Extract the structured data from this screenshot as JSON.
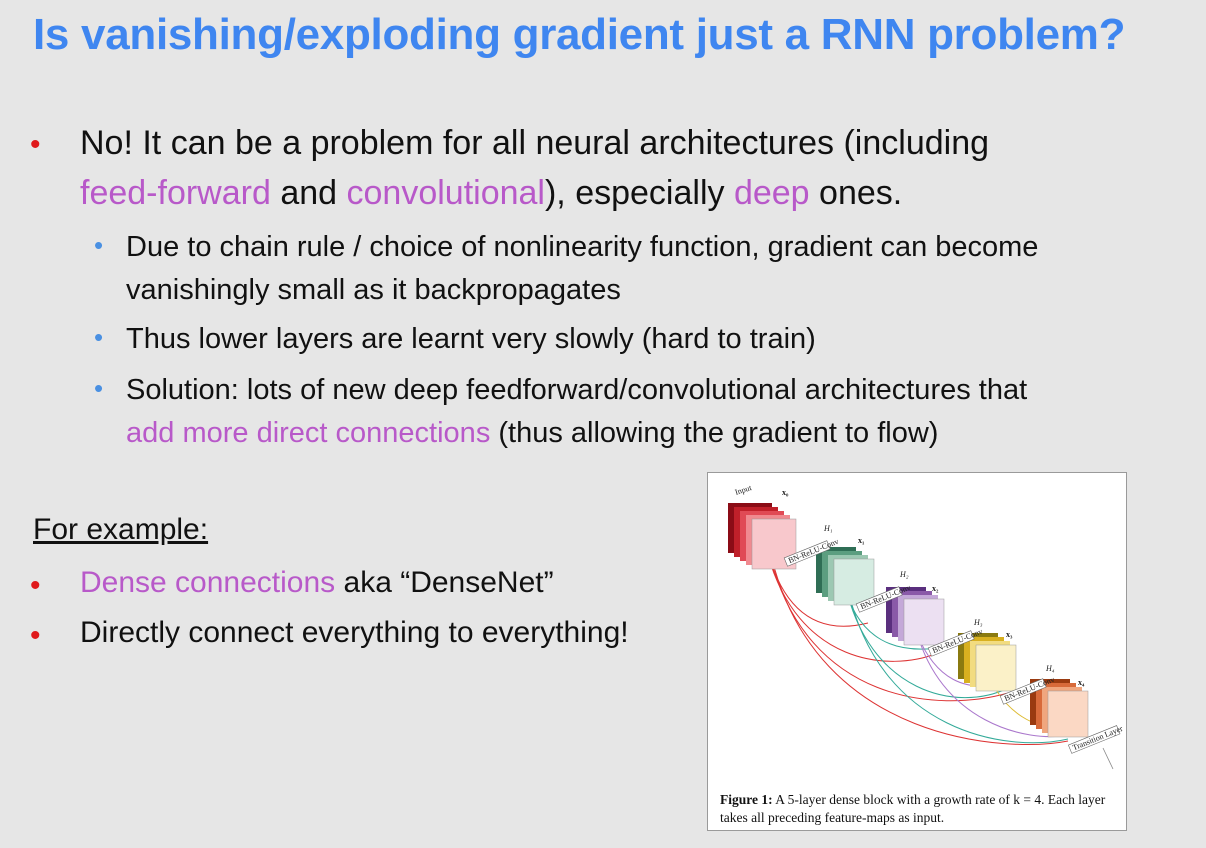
{
  "title": "Is vanishing/exploding gradient just a RNN problem?",
  "main_bullet": {
    "line1": "No! It can be a problem for all neural architectures (including",
    "line2_hl1": "feed-forward",
    "line2_t1": " and ",
    "line2_hl2": "convolutional",
    "line2_t2": "), especially ",
    "line2_hl3": "deep",
    "line2_t3": " ones."
  },
  "sub_bullets": {
    "b1_line1": "Due to chain rule / choice of nonlinearity function, gradient can become",
    "b1_line2": "vanishingly small as it backpropagates",
    "b2": "Thus lower layers are learnt very slowly (hard to train)",
    "b3_line1": "Solution: lots of new deep feedforward/convolutional architectures that",
    "b3_hl": "add more direct connections",
    "b3_rest": " (thus allowing the gradient to flow)"
  },
  "for_example": "For example:",
  "examples": {
    "e1_hl": "Dense connections",
    "e1_rest": " aka “DenseNet”",
    "e2": "Directly connect everything to everything!"
  },
  "figure": {
    "input_label": "Input",
    "x0": "x₀",
    "x1": "x₁",
    "x2": "x₂",
    "x3": "x₃",
    "x4": "x₄",
    "h1": "H₁",
    "h2": "H₂",
    "h3": "H₃",
    "h4": "H₄",
    "bn": "BN-ReLU-Conv",
    "transition": "Transition Layer",
    "caption_bold": "Figure 1:",
    "caption_text": " A 5-layer dense block with a growth rate of k = 4. Each layer takes all preceding feature-maps as input."
  },
  "colors": {
    "title": "#3f86f0",
    "highlight": "#b859c9",
    "red_bullet": "#e0191b",
    "blue_bullet": "#4a90e2",
    "block_red": "#c0202a",
    "block_green": "#5c9e80",
    "block_purple": "#8a5aa8",
    "block_yellow": "#d8b020",
    "block_orange": "#d86a3a"
  }
}
